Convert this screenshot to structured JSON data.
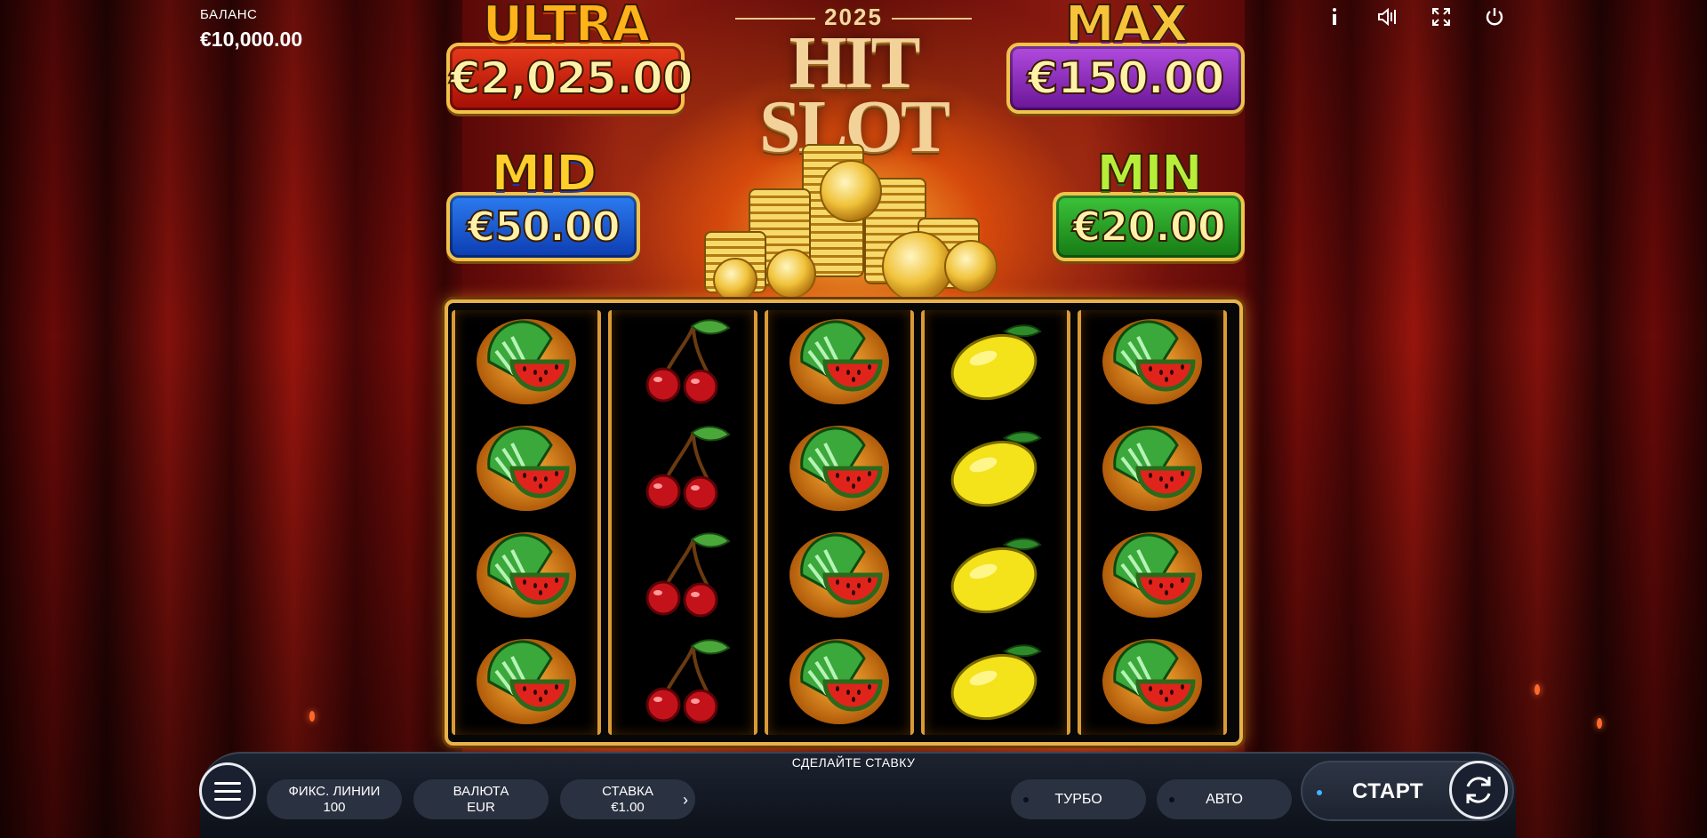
{
  "balance": {
    "label": "БАЛАНС",
    "value": "€10,000.00"
  },
  "logo": {
    "year": "2025",
    "name": "HIT SLOT"
  },
  "jackpots": {
    "ultra": {
      "title": "ULTRA",
      "amount": "€2,025.00"
    },
    "max": {
      "title": "MAX",
      "amount": "€150.00"
    },
    "mid": {
      "title": "MID",
      "amount": "€50.00"
    },
    "min": {
      "title": "MIN",
      "amount": "€20.00"
    }
  },
  "top_icons": [
    "info-icon",
    "sound-icon",
    "fullscreen-icon",
    "power-icon"
  ],
  "reels": [
    [
      "watermelon",
      "watermelon",
      "watermelon",
      "watermelon"
    ],
    [
      "cherry",
      "cherry",
      "cherry",
      "cherry"
    ],
    [
      "watermelon",
      "watermelon",
      "watermelon",
      "watermelon"
    ],
    [
      "lemon",
      "lemon",
      "lemon",
      "lemon"
    ],
    [
      "watermelon",
      "watermelon",
      "watermelon",
      "watermelon"
    ]
  ],
  "bottom": {
    "hint": "СДЕЛАЙТЕ СТАВКУ",
    "lines": {
      "label": "ФИКС. ЛИНИИ",
      "value": "100"
    },
    "currency": {
      "label": "ВАЛЮТА",
      "value": "EUR"
    },
    "bet": {
      "label": "СТАВКА",
      "value": "€1.00"
    },
    "turbo": "ТУРБО",
    "auto": "АВТО",
    "start": "СТАРТ"
  }
}
